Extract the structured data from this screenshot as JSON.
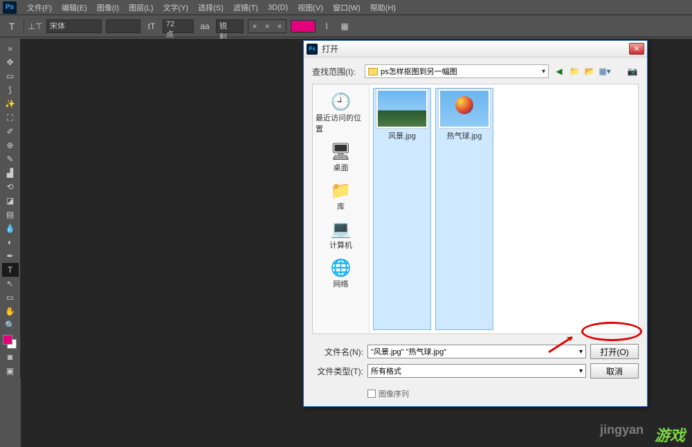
{
  "menubar": {
    "items": [
      "文件(F)",
      "编辑(E)",
      "图像(I)",
      "图层(L)",
      "文字(Y)",
      "选择(S)",
      "滤镜(T)",
      "3D(D)",
      "视图(V)",
      "窗口(W)",
      "帮助(H)"
    ]
  },
  "options": {
    "font": "宋体",
    "style": "",
    "size_label": "72 点",
    "aa": "锐利"
  },
  "dialog": {
    "title": "打开",
    "path_label": "查找范围(I):",
    "path_value": "ps怎样抠图到另一幅图",
    "places": [
      {
        "label": "最近访问的位置",
        "icon": "🕘"
      },
      {
        "label": "桌面",
        "icon": "🖥"
      },
      {
        "label": "库",
        "icon": "📁"
      },
      {
        "label": "计算机",
        "icon": "💻"
      },
      {
        "label": "网络",
        "icon": "🌐"
      }
    ],
    "files": [
      {
        "name": "风景.jpg",
        "type": "sky"
      },
      {
        "name": "热气球.jpg",
        "type": "balloon"
      }
    ],
    "filename_label": "文件名(N):",
    "filename_value": "\"风景.jpg\" \"热气球.jpg\"",
    "filetype_label": "文件类型(T):",
    "filetype_value": "所有格式",
    "open_btn": "打开(O)",
    "cancel_btn": "取消",
    "sequence_chk": "图像序列"
  },
  "watermark": {
    "text1": "jingyan",
    "text2": "游戏"
  }
}
